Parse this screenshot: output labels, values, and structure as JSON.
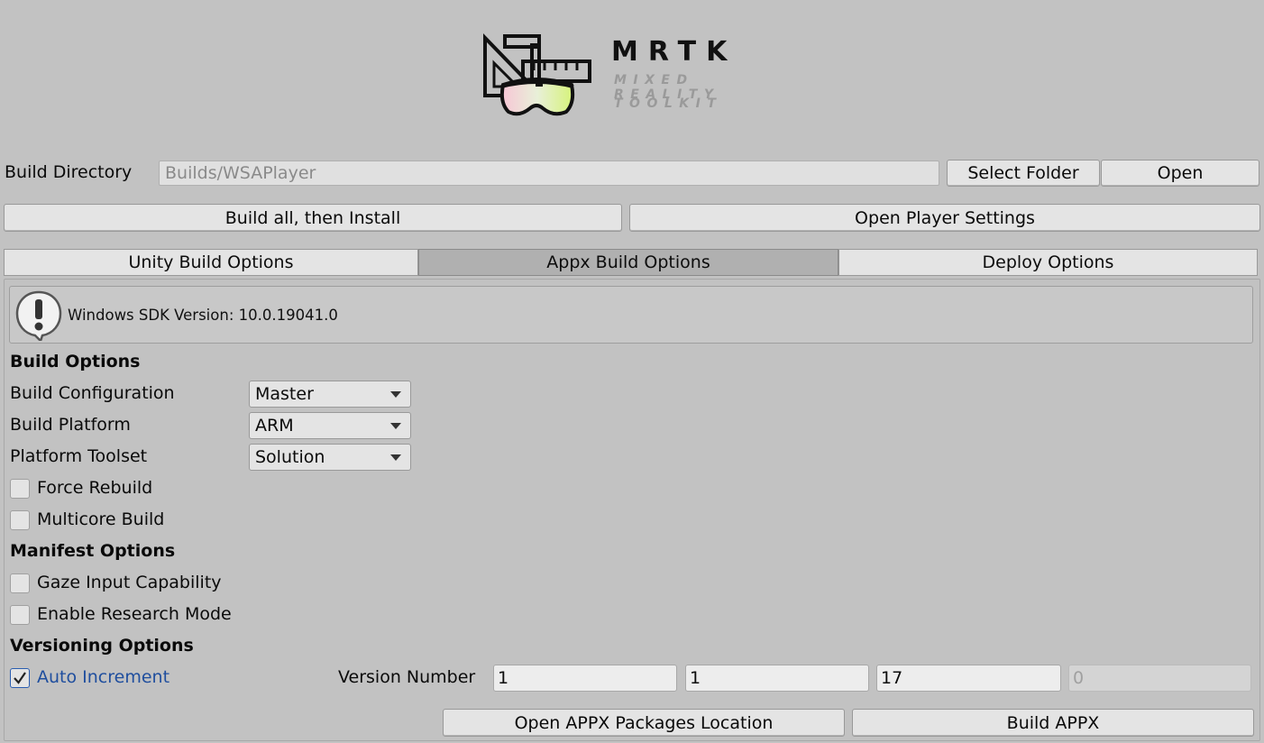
{
  "logo": {
    "title": "MRTK",
    "subtitle_line1": "MIXED REALITY",
    "subtitle_line2": "TOOLKIT"
  },
  "build_directory": {
    "label": "Build Directory",
    "value": "Builds/WSAPlayer",
    "select_folder_label": "Select Folder",
    "open_label": "Open"
  },
  "actions": {
    "build_all_label": "Build all, then Install",
    "open_player_settings_label": "Open Player Settings"
  },
  "tabs": [
    {
      "label": "Unity Build Options",
      "active": false
    },
    {
      "label": "Appx Build Options",
      "active": true
    },
    {
      "label": "Deploy Options",
      "active": false
    }
  ],
  "help": {
    "text": "Windows SDK Version: 10.0.19041.0"
  },
  "build_options": {
    "heading": "Build Options",
    "configuration": {
      "label": "Build Configuration",
      "value": "Master"
    },
    "platform": {
      "label": "Build Platform",
      "value": "ARM"
    },
    "toolset": {
      "label": "Platform Toolset",
      "value": "Solution"
    },
    "force_rebuild": {
      "label": "Force Rebuild",
      "checked": false
    },
    "multicore_build": {
      "label": "Multicore Build",
      "checked": false
    }
  },
  "manifest_options": {
    "heading": "Manifest Options",
    "gaze_input": {
      "label": "Gaze Input Capability",
      "checked": false
    },
    "research_mode": {
      "label": "Enable Research Mode",
      "checked": false
    }
  },
  "versioning_options": {
    "heading": "Versioning Options",
    "auto_increment": {
      "label": "Auto Increment",
      "checked": true
    },
    "version_number_label": "Version Number",
    "version": [
      "1",
      "1",
      "17",
      "0"
    ]
  },
  "footer": {
    "open_packages_label": "Open APPX Packages Location",
    "build_appx_label": "Build APPX"
  },
  "colors": {
    "background": "#c2c2c2",
    "button": "#e4e4e4",
    "active_tab": "#b0b0b0",
    "link_blue": "#1f4e9e"
  }
}
